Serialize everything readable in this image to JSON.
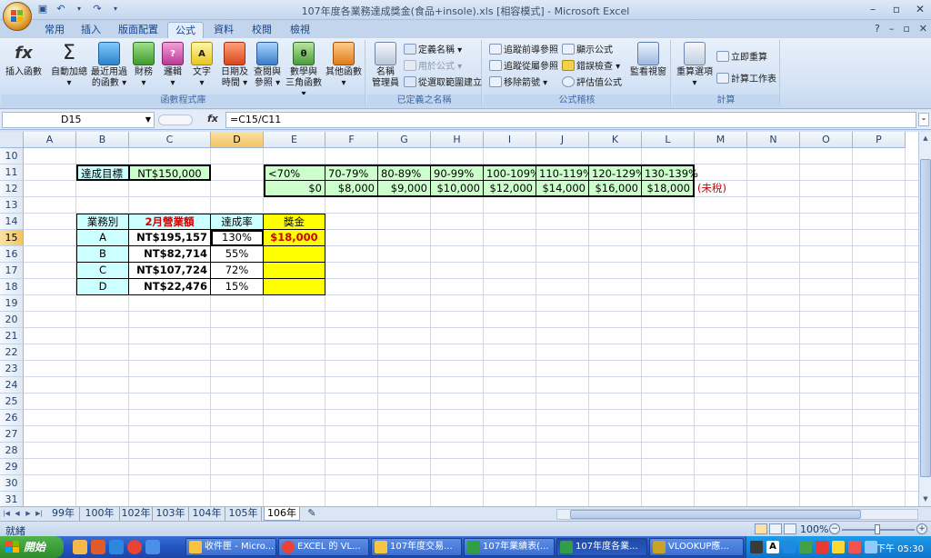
{
  "window": {
    "title": "107年度各業務達成獎金(食品+insole).xls [相容模式] - Microsoft Excel"
  },
  "ribbon_tabs": [
    "常用",
    "插入",
    "版面配置",
    "公式",
    "資料",
    "校閱",
    "檢視"
  ],
  "active_tab": "公式",
  "ribbon": {
    "insert_function": "插入函數",
    "autosum": [
      "自動加總",
      "▾"
    ],
    "recent": [
      "最近用過",
      "的函數 ▾"
    ],
    "financial": [
      "財務",
      "▾"
    ],
    "logical": [
      "邏輯",
      "▾"
    ],
    "text": [
      "文字",
      "▾"
    ],
    "datetime": [
      "日期及",
      "時間 ▾"
    ],
    "lookup": [
      "查閱與",
      "參照 ▾"
    ],
    "math": [
      "數學與",
      "三角函數 ▾"
    ],
    "more": [
      "其他函數",
      "▾"
    ],
    "group_library": "函數程式庫",
    "name_manager": [
      "名稱",
      "管理員"
    ],
    "define_name": "定義名稱 ▾",
    "use_in_formula": "用於公式 ▾",
    "create_from_selection": "從選取範圍建立",
    "group_names": "已定義之名稱",
    "trace_precedents": "追蹤前導參照",
    "trace_dependents": "追蹤從屬參照",
    "remove_arrows": "移除箭號 ▾",
    "show_formulas": "顯示公式",
    "error_checking": "錯誤檢查 ▾",
    "evaluate_formula": "評估值公式",
    "watch_window": "監看視窗",
    "group_auditing": "公式稽核",
    "calc_options": [
      "重算選項",
      "▾"
    ],
    "calc_now": "立即重算",
    "calc_sheet": "計算工作表",
    "group_calc": "計算"
  },
  "formula_bar": {
    "name_box": "D15",
    "fx": "fx",
    "formula": "=C15/C11"
  },
  "columns": [
    "A",
    "B",
    "C",
    "D",
    "E",
    "F",
    "G",
    "H",
    "I",
    "J",
    "K",
    "L",
    "M",
    "N",
    "O",
    "P"
  ],
  "selected_column": "D",
  "rows": [
    "10",
    "11",
    "12",
    "13",
    "14",
    "15",
    "16",
    "17",
    "18",
    "19",
    "20",
    "21",
    "22",
    "23",
    "24",
    "25",
    "26",
    "27",
    "28",
    "29",
    "30",
    "31"
  ],
  "selected_row": "15",
  "cells": {
    "B11": "達成目標",
    "C11": "NT$150,000",
    "tiers": [
      "<70%",
      "70-79%",
      "80-89%",
      "90-99%",
      "100-109%",
      "110-119%",
      "120-129%",
      "130-139%"
    ],
    "bonuses": [
      "$0",
      "$8,000",
      "$9,000",
      "$10,000",
      "$12,000",
      "$14,000",
      "$16,000",
      "$18,000"
    ],
    "M12": "(未稅)",
    "headers": [
      "業務別",
      "2月營業額",
      "達成率",
      "獎金"
    ],
    "staff": [
      {
        "name": "A",
        "sales": "NT$195,157",
        "rate": "130%",
        "bonus": "$18,000"
      },
      {
        "name": "B",
        "sales": "NT$82,714",
        "rate": "55%",
        "bonus": ""
      },
      {
        "name": "C",
        "sales": "NT$107,724",
        "rate": "72%",
        "bonus": ""
      },
      {
        "name": "D",
        "sales": "NT$22,476",
        "rate": "15%",
        "bonus": ""
      }
    ]
  },
  "sheet_tabs": [
    "99年",
    "100年",
    "102年",
    "103年",
    "104年",
    "105年",
    "106年"
  ],
  "active_sheet": "106年",
  "status": {
    "ready": "就緒",
    "zoom": "100%"
  },
  "taskbar": {
    "start": "開始",
    "tasks": [
      "收件匣 - Micro...",
      "EXCEL 的 VL...",
      "107年度交易...",
      "107年業績表(...",
      "107年度各業...",
      "VLOOKUP應..."
    ],
    "clock": "下午 05:30"
  },
  "colors": {
    "header_cyan": "#ccffff",
    "tier_green": "#ccffcc",
    "bonus_yellow": "#ffff00",
    "red_text": "#cc0000"
  }
}
